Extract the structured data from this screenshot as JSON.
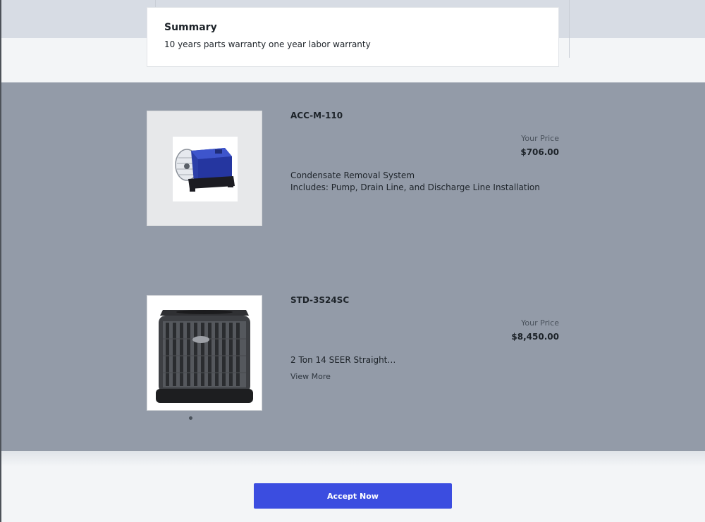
{
  "summary": {
    "title": "Summary",
    "text": "10 years parts warranty one year labor warranty"
  },
  "products": [
    {
      "sku": "ACC-M-110",
      "price_label": "Your Price",
      "price": "$706.00",
      "description_lines": [
        "Condensate Removal System",
        "Includes: Pump, Drain Line, and Discharge Line Installation"
      ],
      "image_icon": "condensate-pump-icon"
    },
    {
      "sku": "STD-3S24SC",
      "price_label": "Your Price",
      "price": "$8,450.00",
      "description_lines": [
        "2 Ton 14 SEER Straight…"
      ],
      "view_more": "View More",
      "image_icon": "ac-condenser-icon"
    }
  ],
  "actions": {
    "accept_label": "Accept Now"
  },
  "colors": {
    "accent": "#3b4de0",
    "products_background": "#939ba8",
    "page_background": "#f3f5f7"
  }
}
